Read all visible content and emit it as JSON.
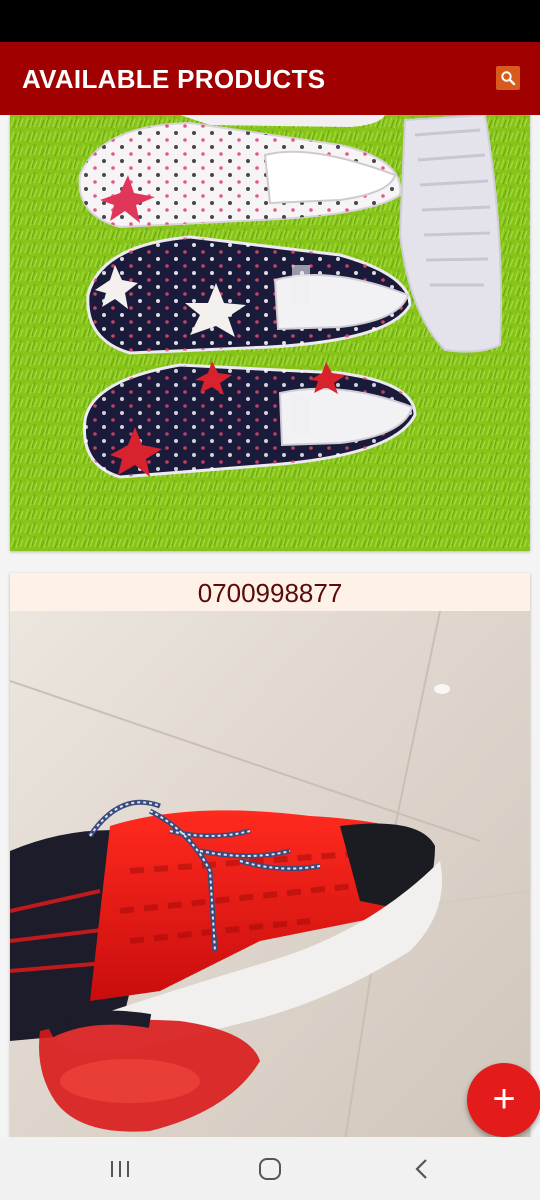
{
  "app": {
    "title": "AVAILABLE PRODUCTS",
    "accent_color": "#a00000",
    "search_icon": "search-icon"
  },
  "products": [
    {
      "phone": "",
      "image": "polka-dot slip-on sneakers on green rug"
    },
    {
      "phone": "0700998877",
      "image": "red sneaker on tiled floor"
    }
  ],
  "fab": {
    "label": "+",
    "icon": "add-icon"
  },
  "nav": {
    "icons": [
      "recents-icon",
      "home-icon",
      "back-icon"
    ]
  }
}
